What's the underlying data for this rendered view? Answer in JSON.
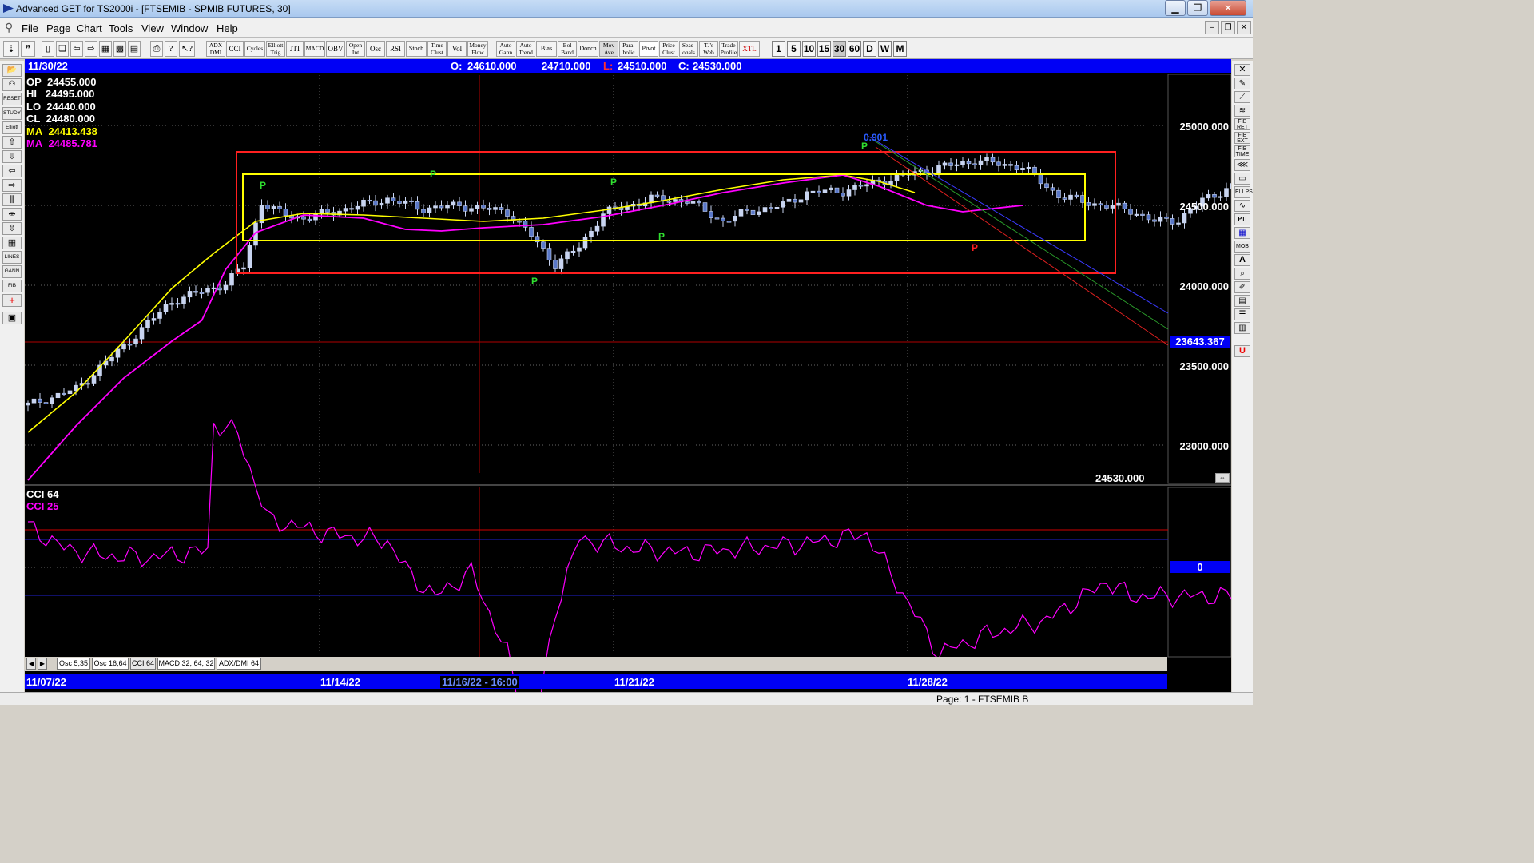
{
  "window": {
    "title": "Advanced GET for TS2000i - [FTSEMIB - SPMIB FUTURES, 30]",
    "minimize_label": "▁",
    "maximize_label": "❐",
    "close_label": "✕"
  },
  "menu": {
    "items": [
      "File",
      "Page",
      "Chart",
      "Tools",
      "View",
      "Window",
      "Help"
    ],
    "mdi_minimize": "–",
    "mdi_restore": "❐",
    "mdi_close": "✕"
  },
  "toolbar": {
    "study_buttons": [
      "ADX DMI",
      "CCI",
      "Cycles",
      "Elliott Trig",
      "JTI",
      "MACD",
      "OBV",
      "Open Int",
      "Osc",
      "RSI",
      "Stoch",
      "Time Clust",
      "Vol",
      "Money Flow",
      "Auto Gann",
      "Auto Trend",
      "Bias",
      "Bol Band",
      "Donch",
      "Mov Ave",
      "Para-bolic",
      "Pivot",
      "Price Clust",
      "Seas-onals",
      "TJ's Web",
      "Trade Profile",
      "XTL"
    ],
    "timeframes": [
      "1",
      "5",
      "10",
      "15",
      "30",
      "60",
      "D",
      "W",
      "M"
    ],
    "active_timeframe": "30"
  },
  "left_tools": [
    "RESET",
    "STUDY",
    "Elliott",
    "LINES",
    "GANN",
    "FIB"
  ],
  "right_tools": [
    "FIB RET",
    "FIB EXT",
    "FIB TIME",
    "ELLPS",
    "PTI",
    "MOB",
    "A",
    "U"
  ],
  "chart": {
    "date_label": "11/30/22",
    "ohlc_top": {
      "open_label": "O:",
      "open": "24610.000",
      "high": "24710.000",
      "low_label": "L:",
      "low": "24510.000",
      "close_label": "C:",
      "close": "24530.000"
    },
    "legend": [
      {
        "label": "OP",
        "value": "24455.000",
        "color": "#ffffff"
      },
      {
        "label": "HI",
        "value": "24495.000",
        "color": "#ffffff"
      },
      {
        "label": "LO",
        "value": "24440.000",
        "color": "#ffffff"
      },
      {
        "label": "CL",
        "value": "24480.000",
        "color": "#ffffff"
      },
      {
        "label": "MA",
        "value": "24413.438",
        "color": "#ffff00"
      },
      {
        "label": "MA",
        "value": "24485.781",
        "color": "#ff00ff"
      }
    ],
    "price_levels": [
      "25000.000",
      "24500.000",
      "24000.000",
      "23500.000",
      "23000.000"
    ],
    "crosshair_price": "23643.367",
    "last_price": "24530.000",
    "fib_label": "0.901",
    "pivot_mark": "P",
    "cci_legend": [
      {
        "label": "CCI 64",
        "color": "#ffffff"
      },
      {
        "label": "CCI  25",
        "color": "#ff00ff"
      }
    ],
    "cci_zero": "0",
    "date_axis": [
      "11/07/22",
      "11/14/22",
      "11/16/22 - 16:00",
      "11/21/22",
      "11/28/22"
    ],
    "study_tabs": [
      "Osc 5,35",
      "Osc 16,64",
      "CCI 64",
      "MACD 32, 64, 32",
      "ADX/DMI 64"
    ],
    "active_tab": "CCI 64"
  },
  "chart_data": {
    "type": "candlestick",
    "price_axis": {
      "min": 22800,
      "max": 25300,
      "ticks": [
        23000,
        23500,
        24000,
        24500,
        25000
      ]
    },
    "moving_average_yellow": [
      [
        0,
        23080
      ],
      [
        8,
        23330
      ],
      [
        16,
        23650
      ],
      [
        24,
        23980
      ],
      [
        31,
        24200
      ],
      [
        38,
        24400
      ],
      [
        46,
        24450
      ],
      [
        56,
        24440
      ],
      [
        66,
        24420
      ],
      [
        76,
        24400
      ],
      [
        86,
        24420
      ],
      [
        96,
        24470
      ],
      [
        106,
        24530
      ],
      [
        116,
        24600
      ],
      [
        126,
        24660
      ],
      [
        136,
        24690
      ],
      [
        142,
        24650
      ],
      [
        148,
        24580
      ]
    ],
    "moving_average_magenta": [
      [
        0,
        22780
      ],
      [
        8,
        23120
      ],
      [
        16,
        23420
      ],
      [
        24,
        23650
      ],
      [
        29,
        23780
      ],
      [
        33,
        24100
      ],
      [
        38,
        24330
      ],
      [
        46,
        24440
      ],
      [
        56,
        24420
      ],
      [
        63,
        24350
      ],
      [
        69,
        24340
      ],
      [
        76,
        24360
      ],
      [
        86,
        24380
      ],
      [
        96,
        24430
      ],
      [
        106,
        24500
      ],
      [
        116,
        24580
      ],
      [
        126,
        24640
      ],
      [
        136,
        24690
      ],
      [
        142,
        24620
      ],
      [
        150,
        24500
      ],
      [
        156,
        24460
      ],
      [
        166,
        24500
      ]
    ],
    "cci_series": [
      [
        0,
        85
      ],
      [
        6,
        40
      ],
      [
        12,
        25
      ],
      [
        20,
        20
      ],
      [
        30,
        35
      ],
      [
        31,
        300
      ],
      [
        35,
        280
      ],
      [
        40,
        100
      ],
      [
        50,
        70
      ],
      [
        60,
        55
      ],
      [
        64,
        -20
      ],
      [
        68,
        -60
      ],
      [
        74,
        -10
      ],
      [
        80,
        -180
      ],
      [
        84,
        -390
      ],
      [
        88,
        -90
      ],
      [
        92,
        60
      ],
      [
        100,
        40
      ],
      [
        110,
        30
      ],
      [
        120,
        40
      ],
      [
        130,
        50
      ],
      [
        140,
        70
      ],
      [
        152,
        -180
      ],
      [
        160,
        -140
      ],
      [
        170,
        -110
      ],
      [
        180,
        -30
      ],
      [
        184,
        -60
      ]
    ],
    "cci_axis": {
      "min": -400,
      "max": 320,
      "zero": 0
    }
  }
}
